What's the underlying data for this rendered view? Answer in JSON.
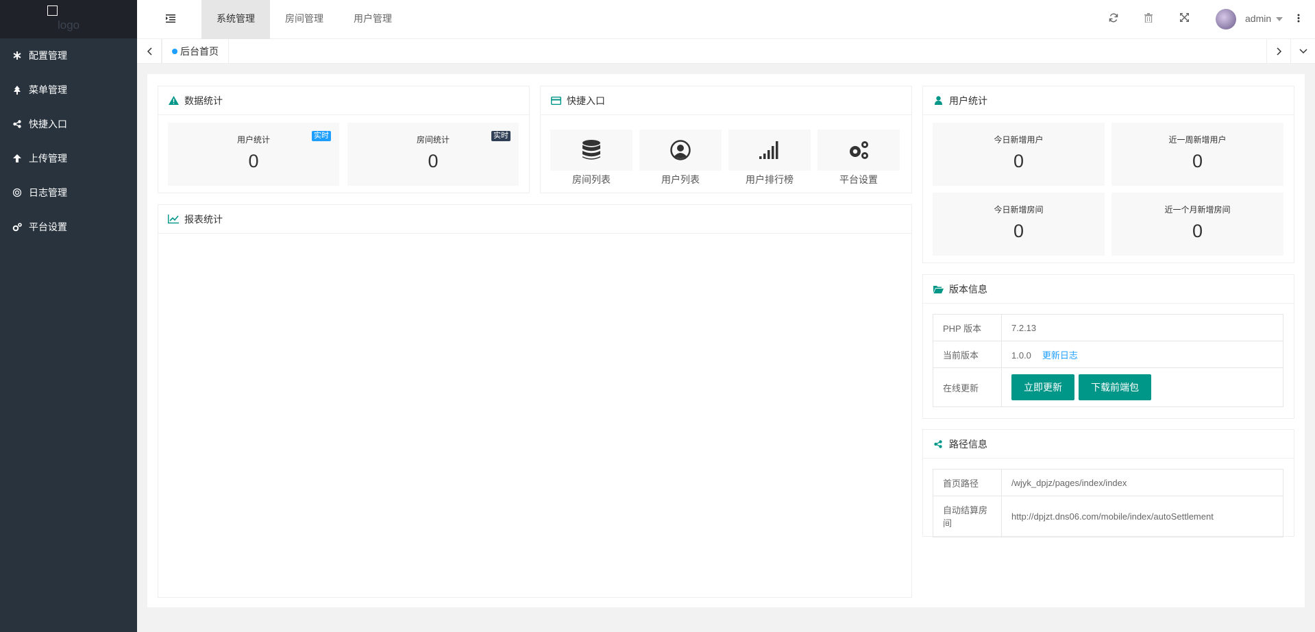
{
  "sidebar": {
    "logo_text": "logo",
    "items": [
      {
        "label": "配置管理",
        "icon": "asterisk-icon"
      },
      {
        "label": "菜单管理",
        "icon": "tree-icon"
      },
      {
        "label": "快捷入口",
        "icon": "share-icon"
      },
      {
        "label": "上传管理",
        "icon": "upload-arrow-icon"
      },
      {
        "label": "日志管理",
        "icon": "log-icon"
      },
      {
        "label": "平台设置",
        "icon": "gears-icon"
      }
    ]
  },
  "header": {
    "tabs": [
      {
        "label": "系统管理",
        "active": true
      },
      {
        "label": "房间管理",
        "active": false
      },
      {
        "label": "用户管理",
        "active": false
      }
    ],
    "user": "admin"
  },
  "tabsbar": {
    "current": "后台首页"
  },
  "data_stats": {
    "title": "数据统计",
    "items": [
      {
        "label": "用户统计",
        "value": "0",
        "badge": "实时",
        "badge_color": "#1e9fff"
      },
      {
        "label": "房间统计",
        "value": "0",
        "badge": "实时",
        "badge_color": "#2f4056"
      }
    ]
  },
  "quick_entry": {
    "title": "快捷入口",
    "items": [
      {
        "label": "房间列表",
        "icon": "database-icon"
      },
      {
        "label": "用户列表",
        "icon": "user-circle-icon"
      },
      {
        "label": "用户排行榜",
        "icon": "signal-bars-icon"
      },
      {
        "label": "平台设置",
        "icon": "gears-icon"
      }
    ]
  },
  "report": {
    "title": "报表统计"
  },
  "user_stats": {
    "title": "用户统计",
    "items": [
      {
        "label": "今日新增用户",
        "value": "0"
      },
      {
        "label": "近一周新增用户",
        "value": "0"
      },
      {
        "label": "今日新增房间",
        "value": "0"
      },
      {
        "label": "近一个月新增房间",
        "value": "0"
      }
    ]
  },
  "version": {
    "title": "版本信息",
    "php_label": "PHP 版本",
    "php_value": "7.2.13",
    "current_label": "当前版本",
    "current_value": "1.0.0",
    "changelog_link": "更新日志",
    "online_label": "在线更新",
    "update_btn": "立即更新",
    "download_btn": "下载前端包"
  },
  "paths": {
    "title": "路径信息",
    "home_label": "首页路径",
    "home_value": "/wjyk_dpjz/pages/index/index",
    "auto_label": "自动结算房间",
    "auto_value": "http://dpjzt.dns06.com/mobile/index/autoSettlement"
  },
  "colors": {
    "accent": "#009688",
    "sidebar_bg": "#28333e",
    "link": "#1e9fff"
  }
}
